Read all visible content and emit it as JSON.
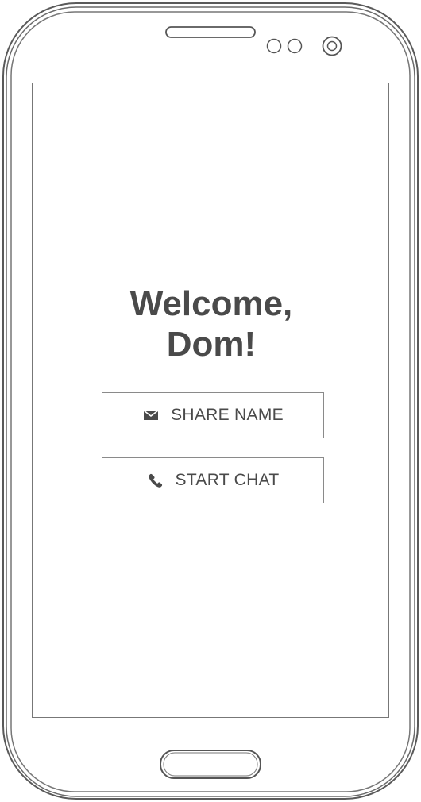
{
  "screen": {
    "title_line1": "Welcome,",
    "title_line2": "Dom!"
  },
  "actions": {
    "share": {
      "label": "SHARE NAME",
      "icon": "envelope-icon"
    },
    "chat": {
      "label": "START CHAT",
      "icon": "phone-icon"
    }
  },
  "colors": {
    "text": "#4a4a4a",
    "outline": "#555555",
    "button_border": "#8a8a8a"
  }
}
